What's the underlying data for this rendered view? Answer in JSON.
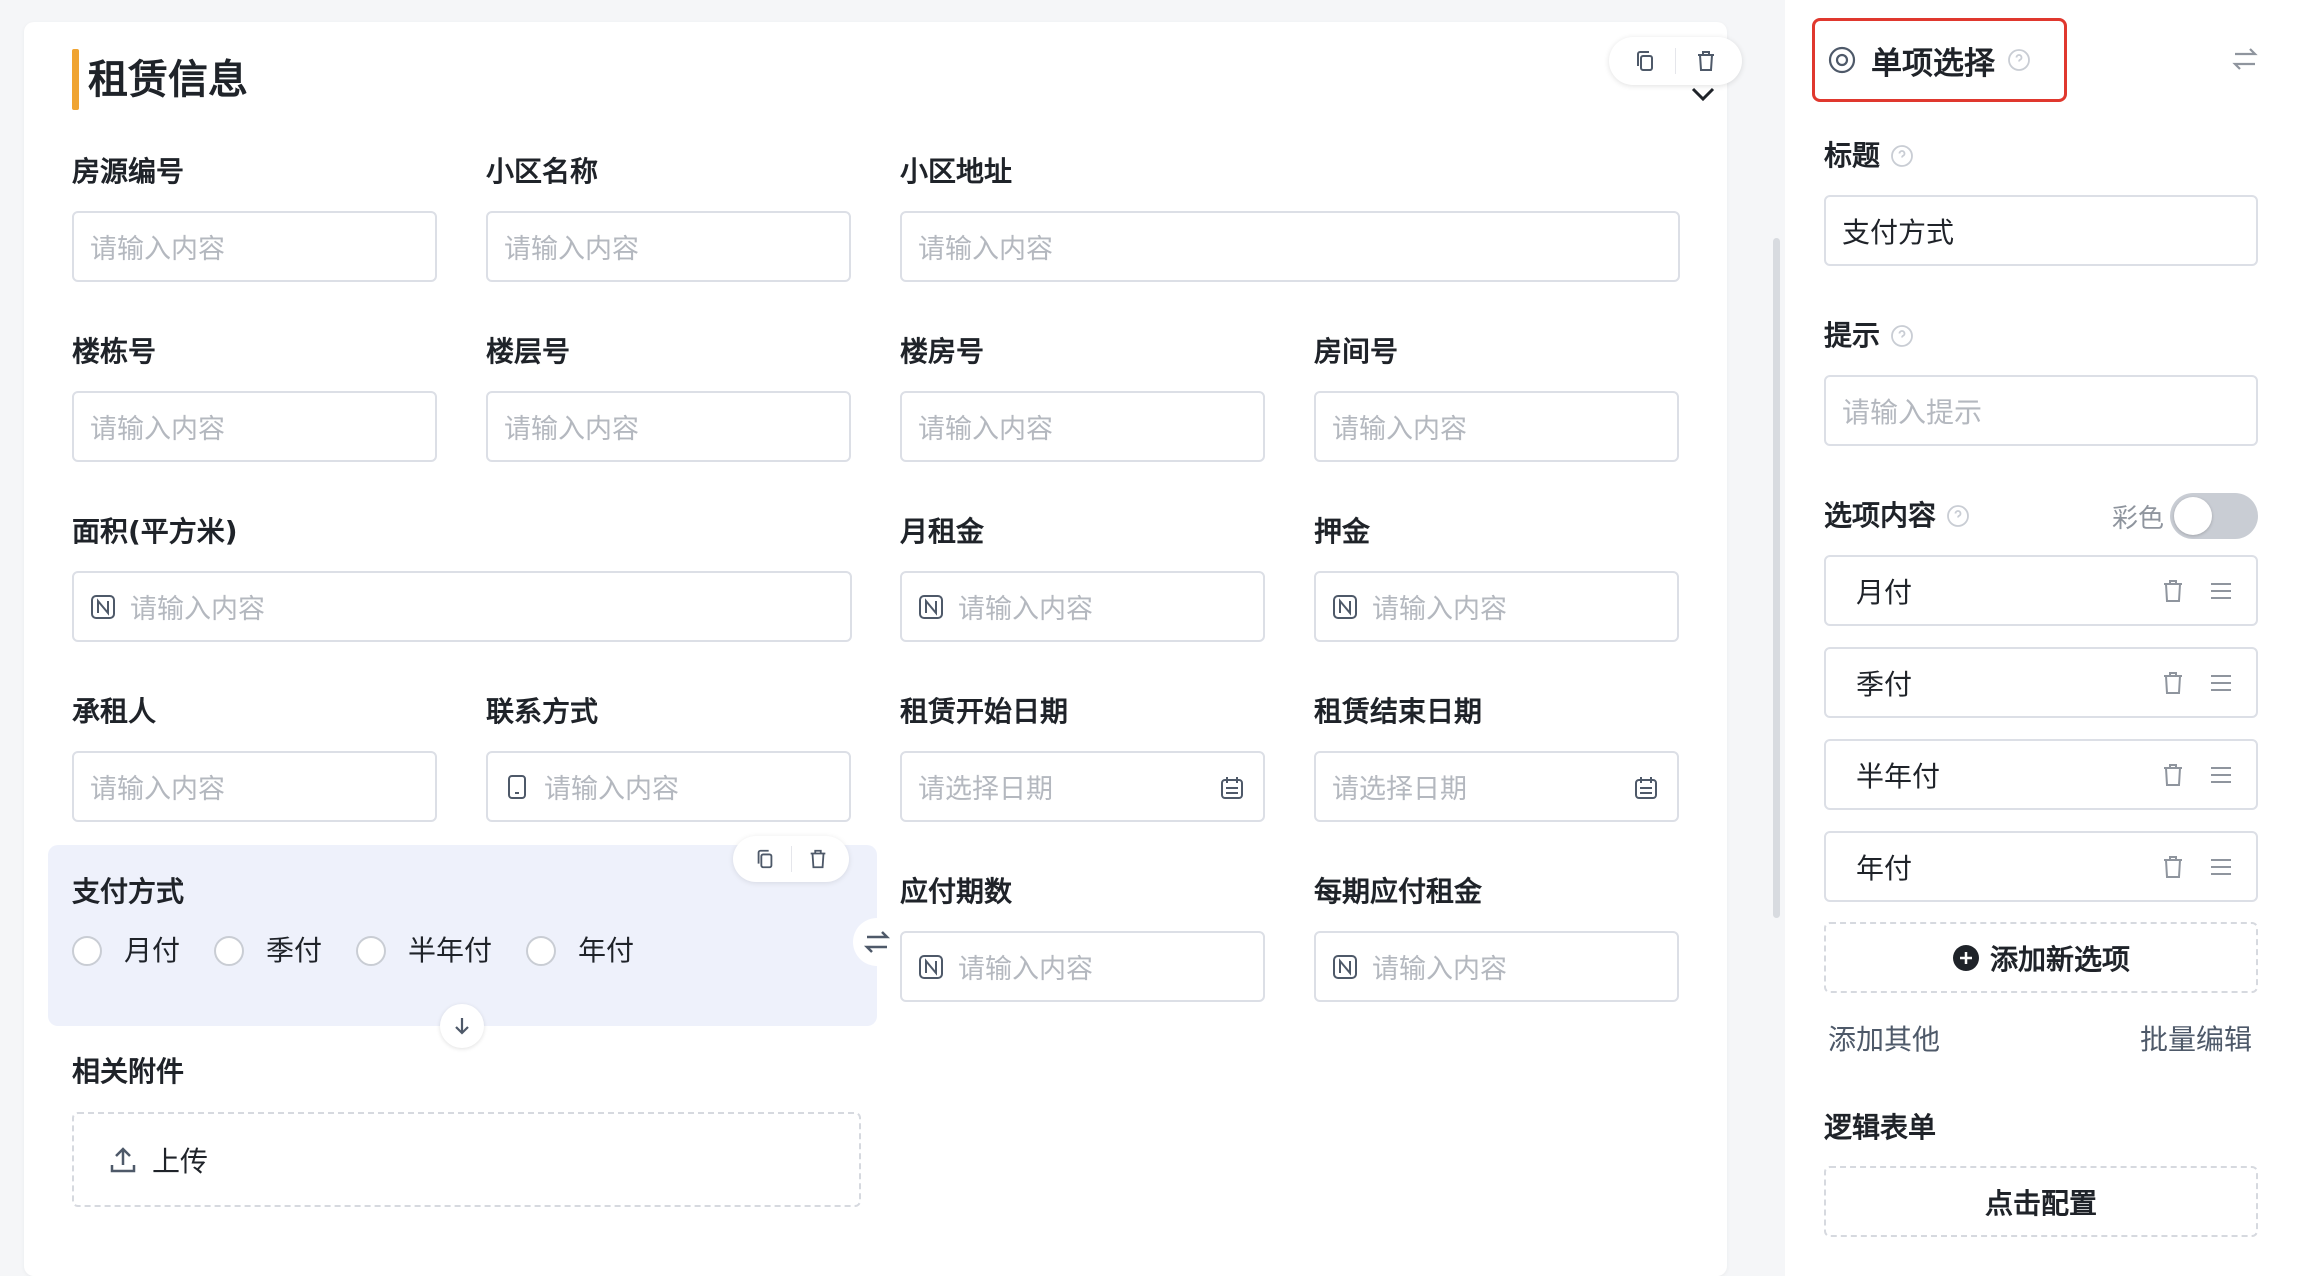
{
  "form": {
    "section_title": "租赁信息",
    "fields": {
      "house_no": {
        "label": "房源编号",
        "placeholder": "请输入内容"
      },
      "community_name": {
        "label": "小区名称",
        "placeholder": "请输入内容"
      },
      "community_address": {
        "label": "小区地址",
        "placeholder": "请输入内容"
      },
      "building_no": {
        "label": "楼栋号",
        "placeholder": "请输入内容"
      },
      "floor_no": {
        "label": "楼层号",
        "placeholder": "请输入内容"
      },
      "unit_no": {
        "label": "楼房号",
        "placeholder": "请输入内容"
      },
      "room_no": {
        "label": "房间号",
        "placeholder": "请输入内容"
      },
      "area": {
        "label": "面积(平方米)",
        "placeholder": "请输入内容"
      },
      "monthly_rent": {
        "label": "月租金",
        "placeholder": "请输入内容"
      },
      "deposit": {
        "label": "押金",
        "placeholder": "请输入内容"
      },
      "tenant": {
        "label": "承租人",
        "placeholder": "请输入内容"
      },
      "contact": {
        "label": "联系方式",
        "placeholder": "请输入内容"
      },
      "start_date": {
        "label": "租赁开始日期",
        "placeholder": "请选择日期"
      },
      "end_date": {
        "label": "租赁结束日期",
        "placeholder": "请选择日期"
      },
      "payment_method": {
        "label": "支付方式",
        "options": [
          "月付",
          "季付",
          "半年付",
          "年付"
        ]
      },
      "payment_periods": {
        "label": "应付期数",
        "placeholder": "请输入内容"
      },
      "rent_per_period": {
        "label": "每期应付租金",
        "placeholder": "请输入内容"
      },
      "attachments": {
        "label": "相关附件",
        "upload_label": "上传"
      }
    }
  },
  "panel": {
    "type_title": "单项选择",
    "title_label": "标题",
    "title_value": "支付方式",
    "hint_label": "提示",
    "hint_placeholder": "请输入提示",
    "options_label": "选项内容",
    "color_label": "彩色",
    "color_enabled": false,
    "options": [
      "月付",
      "季付",
      "半年付",
      "年付"
    ],
    "add_option": "添加新选项",
    "add_other": "添加其他",
    "batch_edit": "批量编辑",
    "logic_label": "逻辑表单",
    "config_button": "点击配置"
  },
  "colors": {
    "section_accent": "#f0a431",
    "highlight_border": "#e0382e",
    "selected_field_bg": "#eef1fb"
  }
}
